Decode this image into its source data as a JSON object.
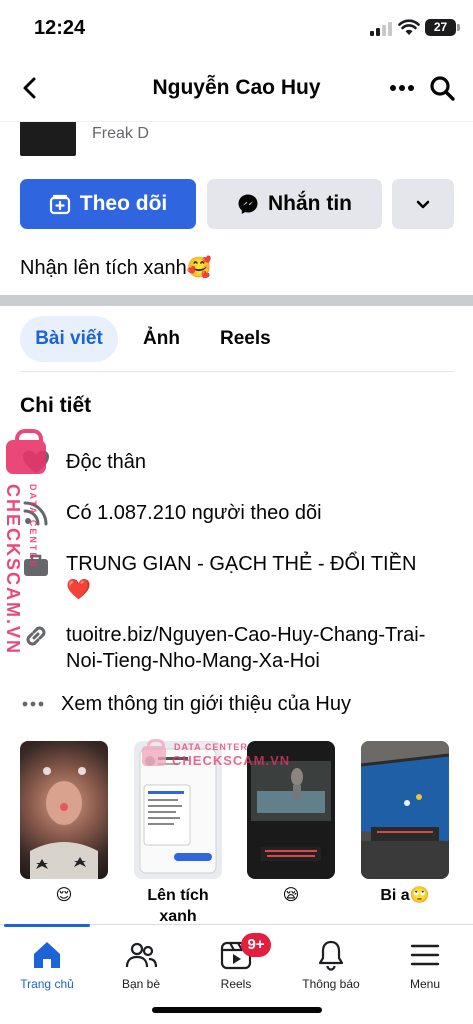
{
  "status_bar": {
    "time": "12:24",
    "battery": "27"
  },
  "header": {
    "title": "Nguyễn Cao Huy"
  },
  "peek": {
    "subtitle": "Freak D"
  },
  "actions": {
    "follow_label": "Theo dõi",
    "message_label": "Nhắn tin"
  },
  "bio": "Nhận lên tích xanh🥰",
  "tabs": [
    {
      "label": "Bài viết",
      "active": true
    },
    {
      "label": "Ảnh",
      "active": false
    },
    {
      "label": "Reels",
      "active": false
    }
  ],
  "details": {
    "title": "Chi tiết",
    "relationship": "Độc thân",
    "followers": "Có 1.087.210 người theo dõi",
    "work": "TRUNG GIAN - GẠCH THẺ - ĐỔI TIỀN ❤️",
    "link": "tuoitre.biz/Nguyen-Cao-Huy-Chang-Trai-Noi-Tieng-Nho-Mang-Xa-Hoi",
    "see_more": "Xem thông tin giới thiệu của Huy"
  },
  "gallery": [
    {
      "caption": "😌"
    },
    {
      "caption": "Lên tích xanh"
    },
    {
      "caption": "😪"
    },
    {
      "caption": "Bi a🙄"
    }
  ],
  "watermark": {
    "brand": "CHECKSCAM.VN",
    "sub": "DATA CENTER"
  },
  "bottom_nav": [
    {
      "label": "Trang chủ",
      "active": true
    },
    {
      "label": "Bạn bè"
    },
    {
      "label": "Reels",
      "badge": "9+"
    },
    {
      "label": "Thông báo"
    },
    {
      "label": "Menu"
    }
  ],
  "colors": {
    "accent": "#2f66e0",
    "active_blue": "#1b63d6",
    "badge_red": "#e41e3f",
    "watermark_pink": "#e8356a"
  }
}
